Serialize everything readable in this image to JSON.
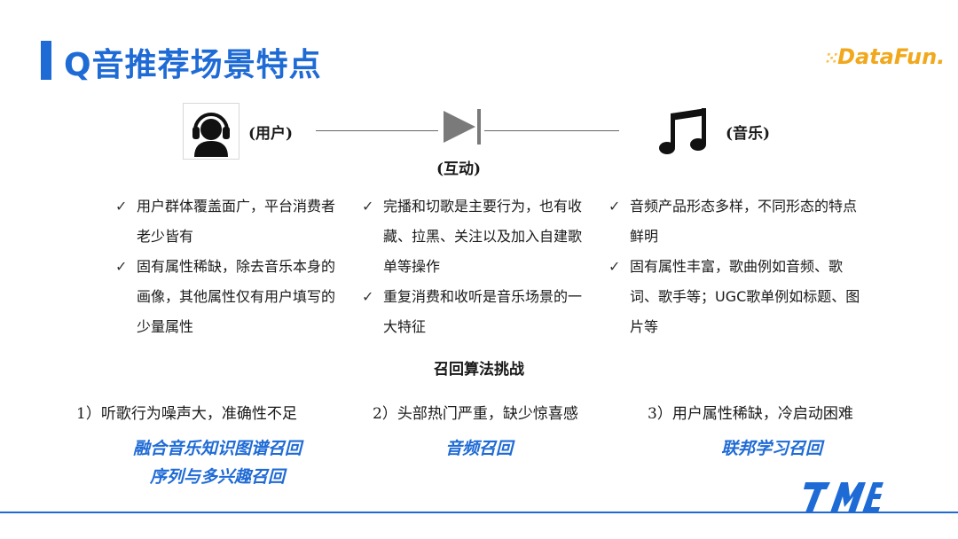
{
  "title": "Q音推荐场景特点",
  "logo": {
    "text": "DataFun."
  },
  "roles": {
    "user": "(用户)",
    "interaction": "(互动)",
    "music": "(音乐)"
  },
  "columns": {
    "user": [
      "用户群体覆盖面广，平台消费者老少皆有",
      "固有属性稀缺，除去音乐本身的画像，其他属性仅有用户填写的少量属性"
    ],
    "interaction": [
      "完播和切歌是主要行为，也有收藏、拉黑、关注以及加入自建歌单等操作",
      "重复消费和收听是音乐场景的一大特征"
    ],
    "music": [
      "音频产品形态多样，不同形态的特点鲜明",
      "固有属性丰富，歌曲例如音频、歌词、歌手等；UGC歌单例如标题、图片等"
    ]
  },
  "challenge_title": "召回算法挑战",
  "problems": [
    "1）听歌行为噪声大，准确性不足",
    "2）头部热门严重，缺少惊喜感",
    "3）用户属性稀缺，冷启动困难"
  ],
  "solutions": {
    "s1_line1": "融合音乐知识图谱召回",
    "s1_line2": "序列与多兴趣召回",
    "s2": "音频召回",
    "s3": "联邦学习召回"
  },
  "colors": {
    "accent": "#1f6bd6",
    "logo": "#f1a81c"
  },
  "icons": {
    "user": "user-headset-icon",
    "interaction": "play-pause-icon",
    "music": "music-note-icon",
    "brand": "tme-logo-icon"
  }
}
